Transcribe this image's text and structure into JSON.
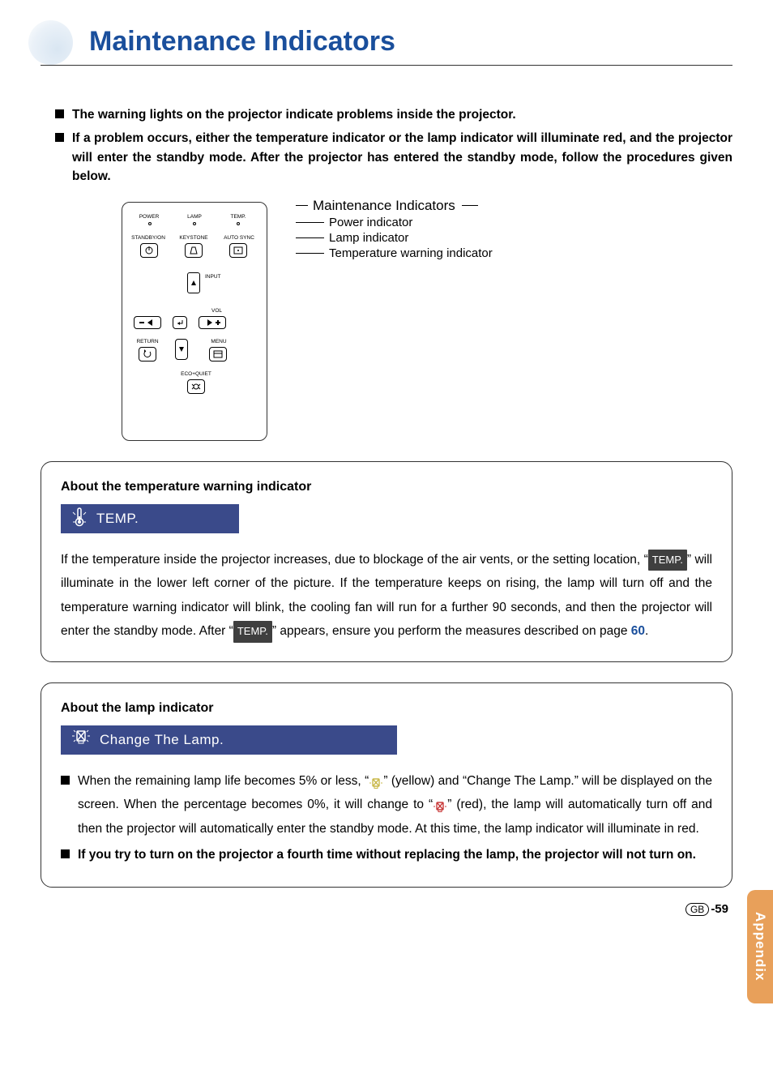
{
  "title": "Maintenance Indicators",
  "intro": {
    "item1": "The warning lights on the projector indicate problems inside the projector.",
    "item2": "If a problem occurs, either the temperature indicator or the lamp indicator will illuminate red, and the projector will enter the standby mode. After the projector has entered the standby mode, follow the procedures given below."
  },
  "diagram": {
    "main_label": "Maintenance Indicators",
    "power": "Power indicator",
    "lamp": "Lamp indicator",
    "temp": "Temperature warning indicator",
    "panel": {
      "power_l": "POWER",
      "lamp_l": "LAMP",
      "temp_l": "TEMP.",
      "standby": "STANDBY/ON",
      "keystone": "KEYSTONE",
      "autosync": "AUTO SYNC",
      "input": "INPUT",
      "vol": "VOL",
      "return": "RETURN",
      "menu": "MENU",
      "eco": "ECO+QUIET"
    }
  },
  "temp_section": {
    "heading": "About the temperature warning indicator",
    "banner": "TEMP.",
    "para_a": "If the temperature inside the projector increases, due to blockage of the air vents, or the setting location, “",
    "inline1": "TEMP.",
    "para_b": "” will illuminate in the lower left corner of the picture. If the temperature keeps on rising, the lamp will turn off and the temperature warning indicator will blink, the cooling fan will run for a further 90 seconds, and then the projector will enter the standby mode. After “",
    "inline2": "TEMP.",
    "para_c": "” appears, ensure you perform the measures described on page ",
    "page_ref": "60",
    "para_d": "."
  },
  "lamp_section": {
    "heading": "About the lamp indicator",
    "banner": "Change The Lamp.",
    "b1_a": "When the remaining lamp life becomes 5% or less, “",
    "b1_b": "” (yellow) and “Change The Lamp.” will be displayed on the screen. When the percentage becomes 0%, it will change to “",
    "b1_c": "” (red), the lamp will automatically turn off and then the projector will automatically enter the standby mode. At this time, the lamp indicator will illuminate in red.",
    "b2": "If you try to turn on the projector a fourth time without replacing the lamp, the projector will not turn on."
  },
  "appendix": "Appendix",
  "footer": {
    "region": "GB",
    "page": "-59"
  }
}
